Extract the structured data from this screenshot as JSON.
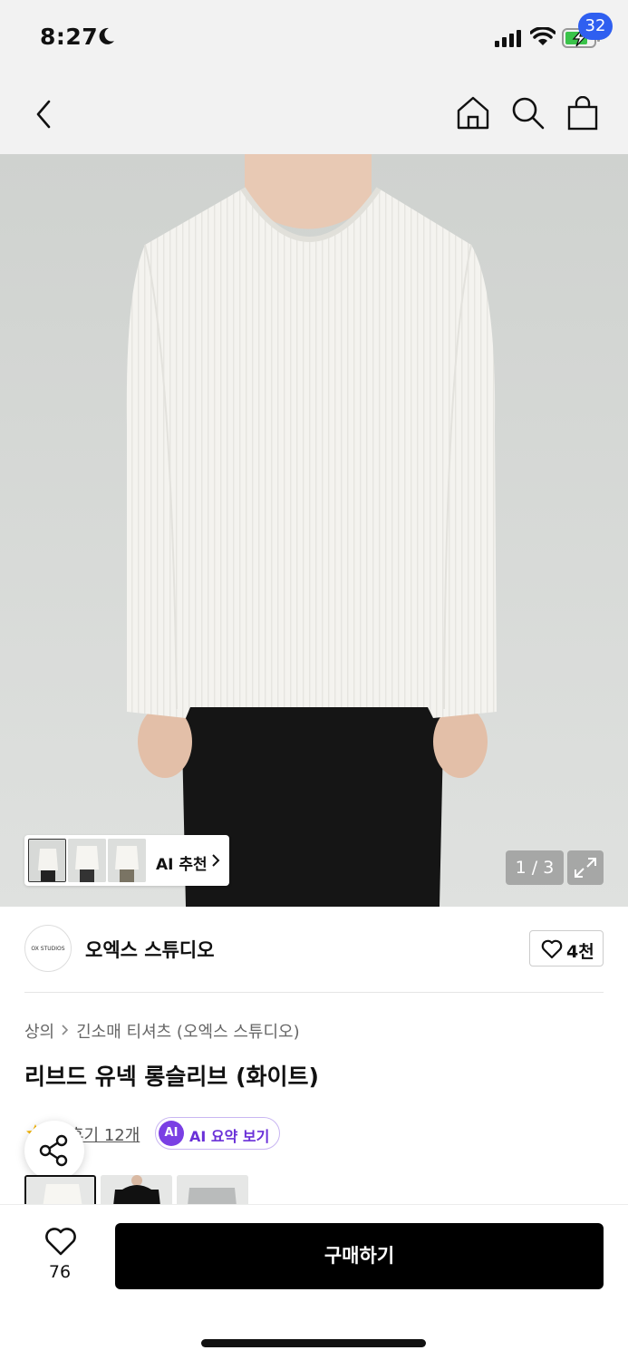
{
  "status_bar": {
    "time": "8:27",
    "icons": [
      "moon-icon",
      "signal-icon",
      "wifi-icon",
      "battery-charging-icon"
    ]
  },
  "nav": {
    "icons": [
      "back-icon",
      "home-icon",
      "search-icon",
      "shopping-bag-icon"
    ],
    "cart_count": "32"
  },
  "gallery": {
    "ai_reco_label": "AI 추천",
    "page_counter": "1 / 3"
  },
  "brand": {
    "logo_text": "OX STUDIOS",
    "name": "오엑스 스튜디오",
    "like_count": "4천"
  },
  "product": {
    "breadcrumb": [
      "상의",
      "긴소매 티셔츠 (오엑스 스튜디오)"
    ],
    "title": "리브드 유넥 롱슬리브 (화이트)",
    "review_link": "후기 12개",
    "ai_badge": "AI",
    "ai_summary_label": "AI 요약 보기"
  },
  "bottom_bar": {
    "wish_count": "76",
    "buy_label": "구매하기"
  },
  "colors": {
    "accent_blue": "#2f5ff0",
    "ai_purple": "#7a3fe4",
    "buy_button": "#000000"
  }
}
